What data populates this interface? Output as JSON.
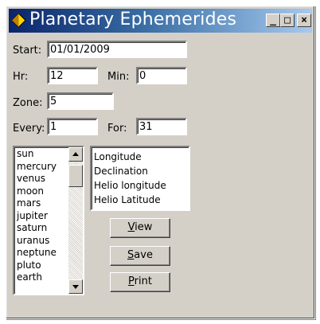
{
  "window": {
    "title": "Planetary Ephemerides",
    "controls": {
      "minimize": "_",
      "maximize": "□",
      "close": "×"
    }
  },
  "form": {
    "start_label": "Start:",
    "start_value": "01/01/2009",
    "hr_label": "Hr:",
    "hr_value": "12",
    "min_label": "Min:",
    "min_value": "0",
    "zone_label": "Zone:",
    "zone_value": "5",
    "every_label": "Every:",
    "every_value": "1",
    "for_label": "For:",
    "for_value": "31"
  },
  "bodies": [
    "sun",
    "mercury",
    "venus",
    "moon",
    "mars",
    "jupiter",
    "saturn",
    "uranus",
    "neptune",
    "pluto",
    "earth"
  ],
  "quantities": [
    "Longitude",
    "Declination",
    "Helio longitude",
    "Helio Latitude"
  ],
  "buttons": {
    "view": {
      "mnemonic": "V",
      "rest": "iew"
    },
    "save": {
      "mnemonic": "S",
      "rest": "ave"
    },
    "print": {
      "mnemonic": "P",
      "rest": "rint"
    }
  },
  "colors": {
    "title_start": "#0a246a",
    "title_end": "#a6caf0",
    "face": "#d4d0c8",
    "icon": "#ffd700"
  }
}
